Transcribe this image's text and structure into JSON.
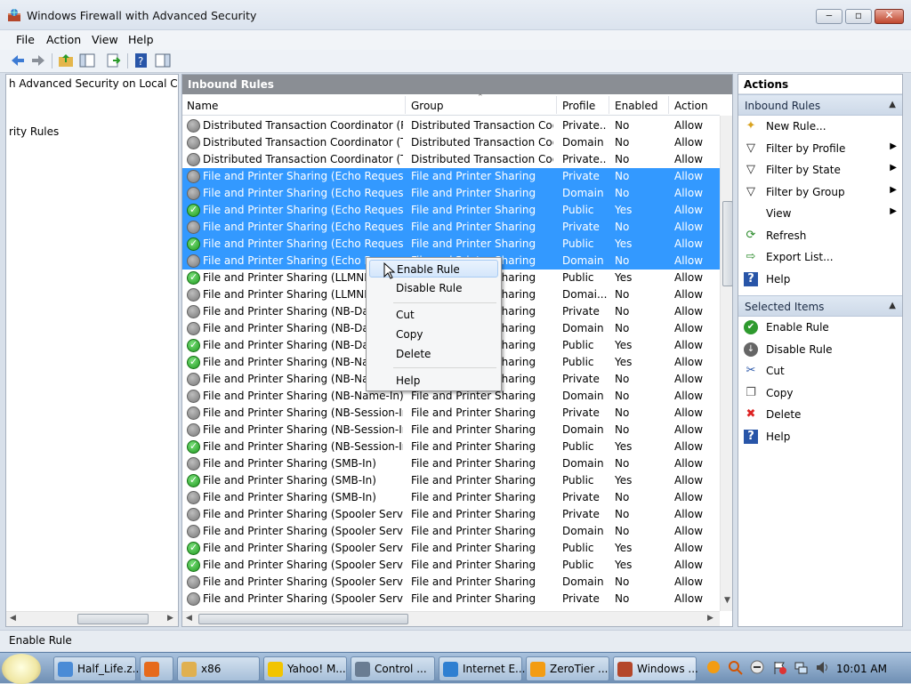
{
  "window": {
    "title": "Windows Firewall with Advanced Security",
    "controls": [
      "minimize",
      "maximize",
      "close"
    ]
  },
  "menu": [
    "File",
    "Action",
    "View",
    "Help"
  ],
  "left_tree": {
    "items": [
      "h Advanced Security on Local Comp",
      "rity Rules"
    ]
  },
  "center": {
    "header": "Inbound Rules",
    "columns": [
      "Name",
      "Group",
      "Profile",
      "Enabled",
      "Action"
    ],
    "rows": [
      {
        "name": "Distributed Transaction Coordinator (RP...",
        "group": "Distributed Transaction Coo...",
        "profile": "Private...",
        "enabled": "No",
        "action": "Allow",
        "on": false,
        "selected": false
      },
      {
        "name": "Distributed Transaction Coordinator (TC...",
        "group": "Distributed Transaction Coo...",
        "profile": "Domain",
        "enabled": "No",
        "action": "Allow",
        "on": false,
        "selected": false
      },
      {
        "name": "Distributed Transaction Coordinator (TC...",
        "group": "Distributed Transaction Coo...",
        "profile": "Private...",
        "enabled": "No",
        "action": "Allow",
        "on": false,
        "selected": false
      },
      {
        "name": "File and Printer Sharing (Echo Request - I...",
        "group": "File and Printer Sharing",
        "profile": "Private",
        "enabled": "No",
        "action": "Allow",
        "on": false,
        "selected": true
      },
      {
        "name": "File and Printer Sharing (Echo Request - I...",
        "group": "File and Printer Sharing",
        "profile": "Domain",
        "enabled": "No",
        "action": "Allow",
        "on": false,
        "selected": true
      },
      {
        "name": "File and Printer Sharing (Echo Request - I...",
        "group": "File and Printer Sharing",
        "profile": "Public",
        "enabled": "Yes",
        "action": "Allow",
        "on": true,
        "selected": true
      },
      {
        "name": "File and Printer Sharing (Echo Request - I...",
        "group": "File and Printer Sharing",
        "profile": "Private",
        "enabled": "No",
        "action": "Allow",
        "on": false,
        "selected": true
      },
      {
        "name": "File and Printer Sharing (Echo Request - I...",
        "group": "File and Printer Sharing",
        "profile": "Public",
        "enabled": "Yes",
        "action": "Allow",
        "on": true,
        "selected": true
      },
      {
        "name": "File and Printer Sharing (Echo Requ",
        "group": "File and Printer Sharing",
        "profile": "Domain",
        "enabled": "No",
        "action": "Allow",
        "on": false,
        "selected": true
      },
      {
        "name": "File and Printer Sharing (LLMNR-UI",
        "group": "File and Printer Sharing",
        "profile": "Public",
        "enabled": "Yes",
        "action": "Allow",
        "on": true,
        "selected": false
      },
      {
        "name": "File and Printer Sharing (LLMNR-UI",
        "group": "File and Printer Sharing",
        "profile": "Domai...",
        "enabled": "No",
        "action": "Allow",
        "on": false,
        "selected": false
      },
      {
        "name": "File and Printer Sharing (NB-Datagr",
        "group": "File and Printer Sharing",
        "profile": "Private",
        "enabled": "No",
        "action": "Allow",
        "on": false,
        "selected": false
      },
      {
        "name": "File and Printer Sharing (NB-Datagr",
        "group": "File and Printer Sharing",
        "profile": "Domain",
        "enabled": "No",
        "action": "Allow",
        "on": false,
        "selected": false
      },
      {
        "name": "File and Printer Sharing (NB-Datagr",
        "group": "File and Printer Sharing",
        "profile": "Public",
        "enabled": "Yes",
        "action": "Allow",
        "on": true,
        "selected": false
      },
      {
        "name": "File and Printer Sharing (NB-Name",
        "group": "File and Printer Sharing",
        "profile": "Public",
        "enabled": "Yes",
        "action": "Allow",
        "on": true,
        "selected": false
      },
      {
        "name": "File and Printer Sharing (NB-Name",
        "group": "File and Printer Sharing",
        "profile": "Private",
        "enabled": "No",
        "action": "Allow",
        "on": false,
        "selected": false
      },
      {
        "name": "File and Printer Sharing (NB-Name-In)",
        "group": "File and Printer Sharing",
        "profile": "Domain",
        "enabled": "No",
        "action": "Allow",
        "on": false,
        "selected": false
      },
      {
        "name": "File and Printer Sharing (NB-Session-In)",
        "group": "File and Printer Sharing",
        "profile": "Private",
        "enabled": "No",
        "action": "Allow",
        "on": false,
        "selected": false
      },
      {
        "name": "File and Printer Sharing (NB-Session-In)",
        "group": "File and Printer Sharing",
        "profile": "Domain",
        "enabled": "No",
        "action": "Allow",
        "on": false,
        "selected": false
      },
      {
        "name": "File and Printer Sharing (NB-Session-In)",
        "group": "File and Printer Sharing",
        "profile": "Public",
        "enabled": "Yes",
        "action": "Allow",
        "on": true,
        "selected": false
      },
      {
        "name": "File and Printer Sharing (SMB-In)",
        "group": "File and Printer Sharing",
        "profile": "Domain",
        "enabled": "No",
        "action": "Allow",
        "on": false,
        "selected": false
      },
      {
        "name": "File and Printer Sharing (SMB-In)",
        "group": "File and Printer Sharing",
        "profile": "Public",
        "enabled": "Yes",
        "action": "Allow",
        "on": true,
        "selected": false
      },
      {
        "name": "File and Printer Sharing (SMB-In)",
        "group": "File and Printer Sharing",
        "profile": "Private",
        "enabled": "No",
        "action": "Allow",
        "on": false,
        "selected": false
      },
      {
        "name": "File and Printer Sharing (Spooler Service -...",
        "group": "File and Printer Sharing",
        "profile": "Private",
        "enabled": "No",
        "action": "Allow",
        "on": false,
        "selected": false
      },
      {
        "name": "File and Printer Sharing (Spooler Service -...",
        "group": "File and Printer Sharing",
        "profile": "Domain",
        "enabled": "No",
        "action": "Allow",
        "on": false,
        "selected": false
      },
      {
        "name": "File and Printer Sharing (Spooler Service -...",
        "group": "File and Printer Sharing",
        "profile": "Public",
        "enabled": "Yes",
        "action": "Allow",
        "on": true,
        "selected": false
      },
      {
        "name": "File and Printer Sharing (Spooler Service -...",
        "group": "File and Printer Sharing",
        "profile": "Public",
        "enabled": "Yes",
        "action": "Allow",
        "on": true,
        "selected": false
      },
      {
        "name": "File and Printer Sharing (Spooler Service -...",
        "group": "File and Printer Sharing",
        "profile": "Domain",
        "enabled": "No",
        "action": "Allow",
        "on": false,
        "selected": false
      },
      {
        "name": "File and Printer Sharing (Spooler Service -...",
        "group": "File and Printer Sharing",
        "profile": "Private",
        "enabled": "No",
        "action": "Allow",
        "on": false,
        "selected": false
      }
    ]
  },
  "context_menu": {
    "items": [
      "Enable Rule",
      "Disable Rule",
      "Cut",
      "Copy",
      "Delete",
      "Help"
    ]
  },
  "actions": {
    "title": "Actions",
    "section1": "Inbound Rules",
    "section1_items": [
      {
        "label": "New Rule...",
        "icon": "new-rule-icon",
        "submenu": false
      },
      {
        "label": "Filter by Profile",
        "icon": "filter-icon",
        "submenu": true
      },
      {
        "label": "Filter by State",
        "icon": "filter-icon",
        "submenu": true
      },
      {
        "label": "Filter by Group",
        "icon": "filter-icon",
        "submenu": true
      },
      {
        "label": "View",
        "icon": "",
        "submenu": true
      },
      {
        "label": "Refresh",
        "icon": "refresh-icon",
        "submenu": false
      },
      {
        "label": "Export List...",
        "icon": "export-icon",
        "submenu": false
      },
      {
        "label": "Help",
        "icon": "help-icon",
        "submenu": false
      }
    ],
    "section2": "Selected Items",
    "section2_items": [
      {
        "label": "Enable Rule",
        "icon": "enable-rule-icon"
      },
      {
        "label": "Disable Rule",
        "icon": "disable-rule-icon"
      },
      {
        "label": "Cut",
        "icon": "cut-icon"
      },
      {
        "label": "Copy",
        "icon": "copy-icon"
      },
      {
        "label": "Delete",
        "icon": "delete-icon"
      },
      {
        "label": "Help",
        "icon": "help-icon"
      }
    ]
  },
  "status": "Enable Rule",
  "taskbar": {
    "tasks": [
      {
        "label": "Half_Life.z...",
        "icon": "chrome-icon",
        "color": "#4a8bd6"
      },
      {
        "label": "",
        "icon": "firefox-icon",
        "color": "#e66a1c"
      },
      {
        "label": "x86",
        "icon": "folder-icon",
        "color": "#e0b050"
      },
      {
        "label": "Yahoo! M...",
        "icon": "yahoo-messenger-icon",
        "color": "#f2c400"
      },
      {
        "label": "Control ...",
        "icon": "control-panel-icon",
        "color": "#6a7c92"
      },
      {
        "label": "Internet E...",
        "icon": "internet-explorer-icon",
        "color": "#2f7fd1"
      },
      {
        "label": "ZeroTier ...",
        "icon": "zerotier-icon",
        "color": "#f39c12"
      },
      {
        "label": "Windows ...",
        "icon": "firewall-icon",
        "color": "#b4472b"
      }
    ],
    "clock": "10:01 AM"
  },
  "colors": {
    "selection": "#3399ff",
    "header_gray": "#8a8e94",
    "action_section": "#cdd9e8"
  }
}
